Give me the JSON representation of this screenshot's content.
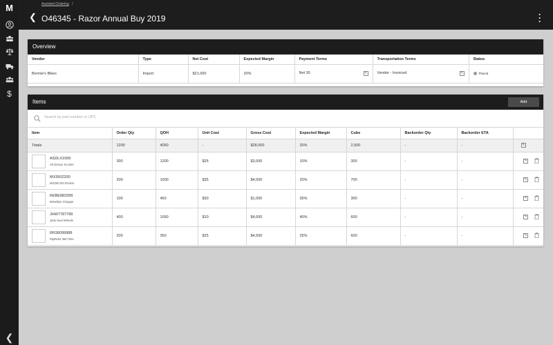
{
  "rail": {
    "logo": "M",
    "icons": [
      "person-icon",
      "group-icon",
      "scale-icon",
      "truck-icon",
      "people-icon",
      "dollar-icon"
    ]
  },
  "breadcrumb": {
    "link": "Assisted Ordering",
    "sep": "/"
  },
  "header": {
    "title": "O46345 - Razor Annual Buy 2019"
  },
  "overview": {
    "title": "Overview",
    "columns": [
      "Vendor",
      "Type",
      "Net Cost",
      "Expected Margin",
      "Payment Terms",
      "Transportation Terms",
      "Status"
    ],
    "row": {
      "vendor": "Bennie's Bikes",
      "type": "Import",
      "net_cost": "$21,000",
      "margin": "20%",
      "payment": "Net 30",
      "transport": "Vendor - Invoiced",
      "status": "Placed"
    }
  },
  "items": {
    "title": "Items",
    "add_label": "Add",
    "search_placeholder": "Search by part number or UPC",
    "columns": [
      "Item",
      "Order Qty",
      "QOH",
      "Unit Cost",
      "Gross Cost",
      "Expected Margin",
      "Cube",
      "Backorder Qty",
      "Backorder ETA",
      ""
    ],
    "totals": [
      "Totals",
      "1200",
      "4050",
      "-",
      "$28,000",
      "20%",
      "2,500",
      "-",
      "-"
    ],
    "rows": [
      {
        "sku": "ASDLX1099",
        "desc": "A5 Deluxe Scooter",
        "qty": "300",
        "qoh": "1200",
        "unit": "$25",
        "gross": "$3,000",
        "margin": "10%",
        "cube": "300",
        "bo_qty": "-",
        "bo_eta": "-"
      },
      {
        "sku": "MX3502200",
        "desc": "MX350 Dirt Rocket",
        "qty": "200",
        "qoh": "1000",
        "unit": "$35",
        "gross": "$4,000",
        "margin": "20%",
        "cube": "700",
        "bo_qty": "-",
        "bo_eta": "-"
      },
      {
        "sku": "REBE883399",
        "desc": "Rebellion Chopper",
        "qty": "100",
        "qoh": "450",
        "unit": "$30",
        "gross": "$1,000",
        "margin": "35%",
        "cube": "300",
        "bo_qty": "-",
        "bo_eta": "-"
      },
      {
        "sku": "JHW7787789",
        "desc": "Jetts Heel Wheels",
        "qty": "400",
        "qoh": "1050",
        "unit": "$10",
        "gross": "$4,000",
        "margin": "40%",
        "cube": "600",
        "bo_qty": "-",
        "bo_eta": "-"
      },
      {
        "sku": "RR36099988",
        "desc": "RipRider 360 Trike",
        "qty": "200",
        "qoh": "350",
        "unit": "$25",
        "gross": "$4,500",
        "margin": "25%",
        "cube": "600",
        "bo_qty": "-",
        "bo_eta": "-"
      }
    ]
  }
}
